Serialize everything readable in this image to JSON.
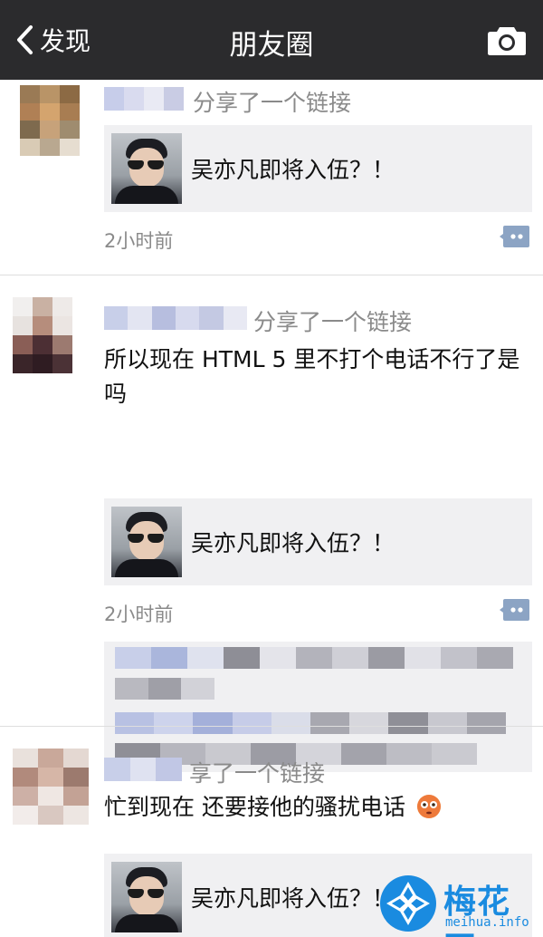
{
  "navbar": {
    "back_label": "发现",
    "title": "朋友圈",
    "camera_icon": "camera-icon"
  },
  "posts": [
    {
      "action": "分享了一个链接",
      "text": "",
      "link_title": "吴亦凡即将入伍？！",
      "time": "2小时前"
    },
    {
      "action": "分享了一个链接",
      "text": "所以现在 HTML 5 里不打个电话不行了是吗",
      "link_title": "吴亦凡即将入伍？！",
      "time": "2小时前"
    },
    {
      "action": "享了一个链接",
      "text": "忙到现在 还要接他的骚扰电话",
      "link_title": "吴亦凡即将入伍？！",
      "time": ""
    }
  ],
  "watermark": {
    "name": "梅花网",
    "domain": "meihua.info"
  },
  "colors": {
    "navbar_bg": "#2b2b2d",
    "card_bg": "#f0f0f2",
    "meta_gray": "#8a8a8a",
    "brand_blue": "#1a8be0"
  }
}
